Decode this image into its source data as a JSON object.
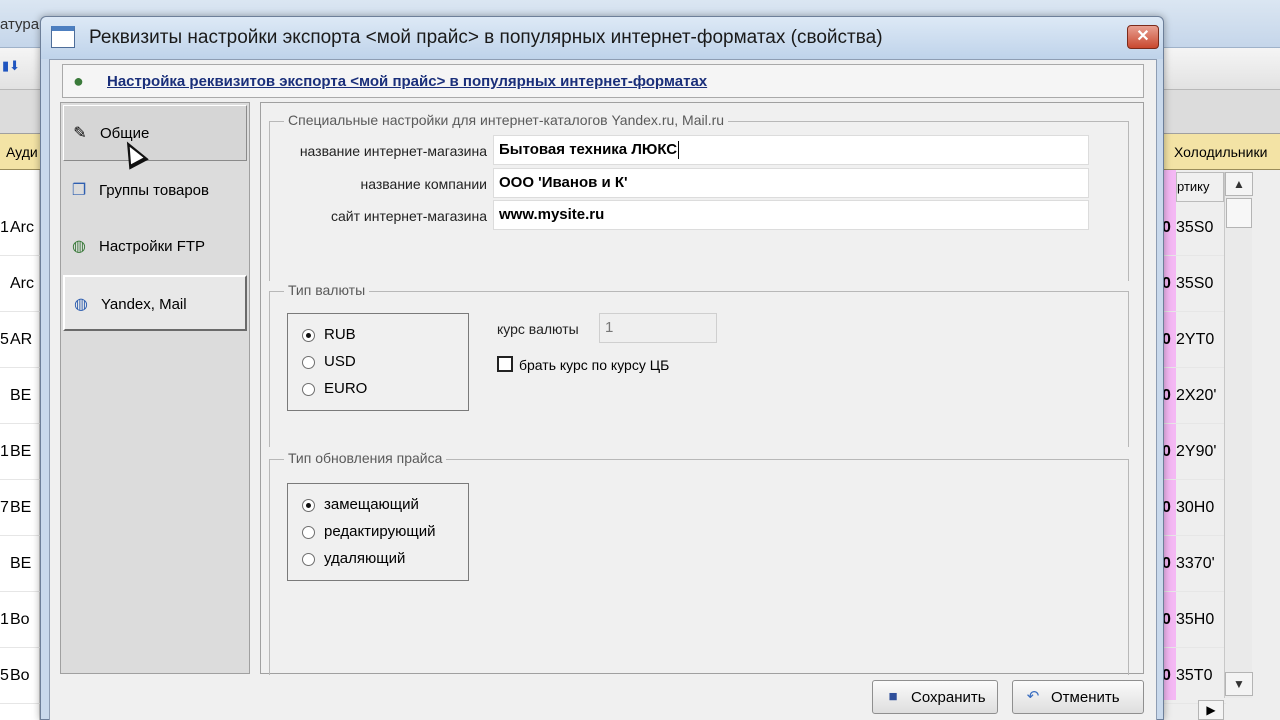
{
  "background_app": {
    "title_fragment": "атура",
    "header_left": "Ауди",
    "header_right": "Холодильники",
    "col_article": "ртику",
    "rows_left": [
      {
        "num": "1",
        "text": "Arc"
      },
      {
        "num": "",
        "text": "Arc"
      },
      {
        "num": "5",
        "text": "AR"
      },
      {
        "num": "",
        "text": "BE"
      },
      {
        "num": "1",
        "text": "BE"
      },
      {
        "num": "7",
        "text": "BE"
      },
      {
        "num": "",
        "text": "BE"
      },
      {
        "num": "1",
        "text": "Bo"
      },
      {
        "num": "5",
        "text": "Bo"
      }
    ],
    "rows_right": [
      "35S0",
      "35S0",
      "2YT0",
      "2X20'",
      "2Y90'",
      "30H0",
      "3370'",
      "35H0",
      "35T0"
    ],
    "row_flag": "0"
  },
  "dialog": {
    "title": "Реквизиты настройки экспорта <мой прайс> в популярных интернет-форматах (свойства)",
    "close_label": "✕",
    "header_link": "Настройка реквизитов экспорта <мой прайс> в популярных интернет-форматах",
    "nav": [
      {
        "label": "Общие",
        "icon": "pencil-icon"
      },
      {
        "label": "Группы товаров",
        "icon": "windows-icon"
      },
      {
        "label": "Настройки FTP",
        "icon": "globe-icon"
      },
      {
        "label": "Yandex, Mail",
        "icon": "globe-plus-icon"
      }
    ],
    "special_group": {
      "legend": "Специальные настройки для интернет-каталогов Yandex.ru, Mail.ru",
      "shop_name_label": "название интернет-магазина",
      "shop_name_value": "Бытовая техника ЛЮКС",
      "company_label": "название компании",
      "company_value": "ООО 'Иванов и К'",
      "site_label": "сайт интернет-магазина",
      "site_value": "www.mysite.ru"
    },
    "currency_group": {
      "legend": "Тип валюты",
      "options": [
        "RUB",
        "USD",
        "EURO"
      ],
      "selected": "RUB",
      "rate_label": "курс валюты",
      "rate_value": "1",
      "cb_label": "брать курс по курсу ЦБ",
      "cb_checked": false
    },
    "update_group": {
      "legend": "Тип обновления прайса",
      "options": [
        "замещающий",
        "редактирующий",
        "удаляющий"
      ],
      "selected": "замещающий"
    },
    "buttons": {
      "save": "Сохранить",
      "cancel": "Отменить"
    }
  }
}
